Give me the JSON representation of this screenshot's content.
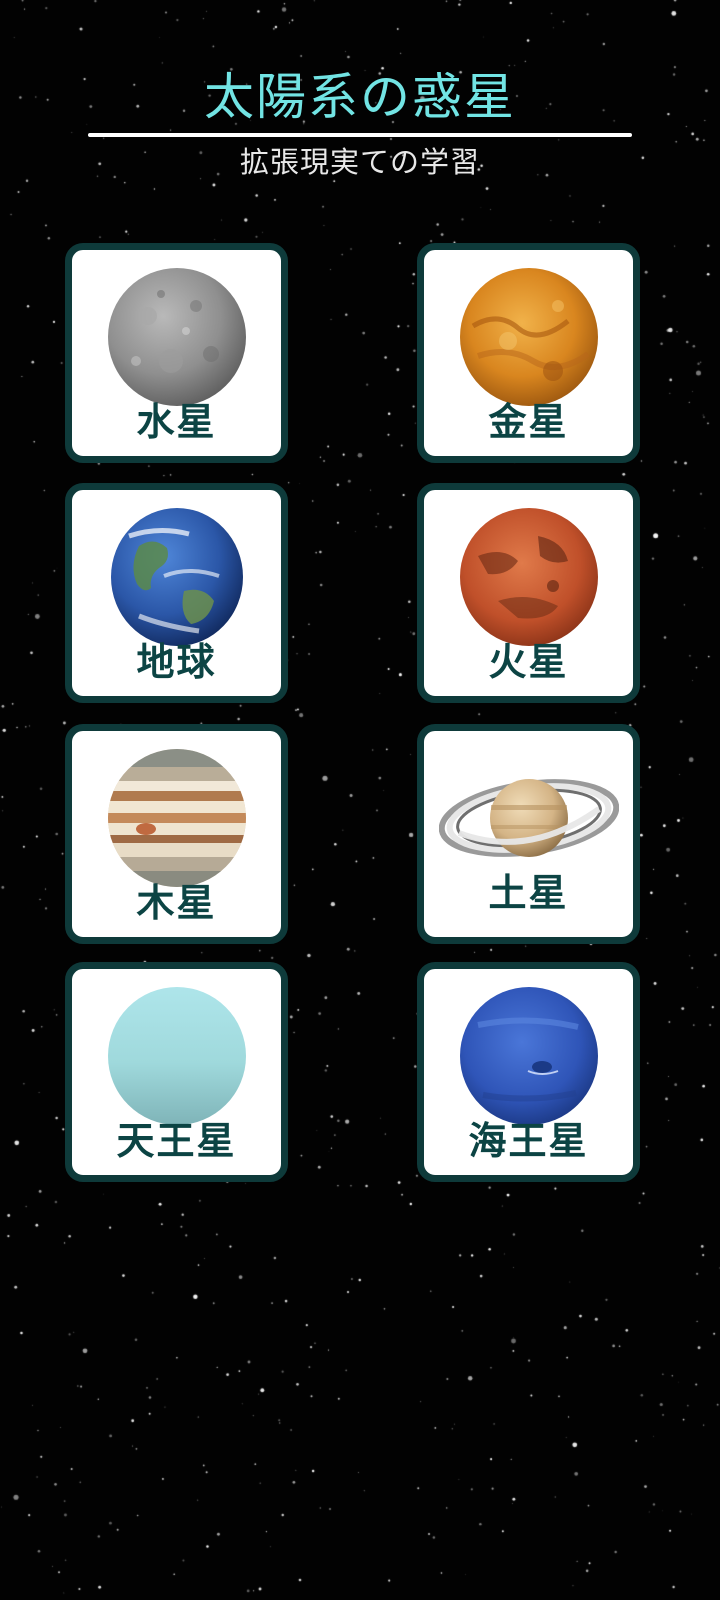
{
  "header": {
    "title": "太陽系の惑星",
    "subtitle": "拡張現実ての学習"
  },
  "planets": [
    {
      "name": "水星",
      "icon": "mercury-icon"
    },
    {
      "name": "金星",
      "icon": "venus-icon"
    },
    {
      "name": "地球",
      "icon": "earth-icon"
    },
    {
      "name": "火星",
      "icon": "mars-icon"
    },
    {
      "name": "木星",
      "icon": "jupiter-icon"
    },
    {
      "name": "土星",
      "icon": "saturn-icon"
    },
    {
      "name": "天王星",
      "icon": "uranus-icon"
    },
    {
      "name": "海王星",
      "icon": "neptune-icon"
    }
  ],
  "colors": {
    "background": "#020202",
    "title": "#72e4e4",
    "card_border": "#0e3a3a",
    "card_label": "#0c4444"
  }
}
